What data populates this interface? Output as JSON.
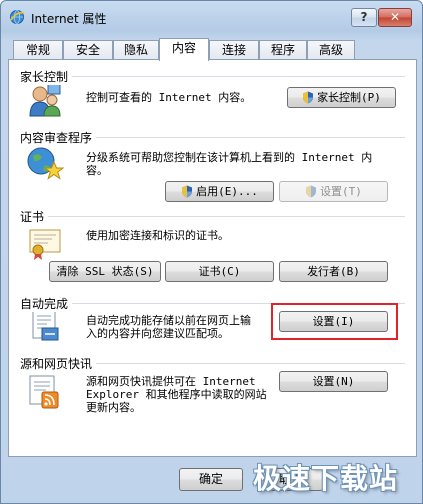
{
  "window": {
    "title": "Internet 属性",
    "help_label": "?",
    "close_label": "✕"
  },
  "tabs": [
    {
      "label": "常规"
    },
    {
      "label": "安全"
    },
    {
      "label": "隐私"
    },
    {
      "label": "内容",
      "active": true
    },
    {
      "label": "连接"
    },
    {
      "label": "程序"
    },
    {
      "label": "高级"
    }
  ],
  "sections": {
    "parental": {
      "title": "家长控制",
      "text": "控制可查看的 Internet 内容。",
      "button": "家长控制(P)",
      "icon": "parental-control-icon"
    },
    "advisor": {
      "title": "内容审查程序",
      "text_line1": "分级系统可帮助您控制在该计算机上看到的 Internet 内",
      "text_line2": "容。",
      "enable_button": "启用(E)...",
      "settings_button": "设置(T)",
      "icon": "content-advisor-icon"
    },
    "certificates": {
      "title": "证书",
      "text": "使用加密连接和标识的证书。",
      "clear_ssl_button": "清除 SSL 状态(S)",
      "certificates_button": "证书(C)",
      "publishers_button": "发行者(B)",
      "icon": "certificate-icon"
    },
    "autocomplete": {
      "title": "自动完成",
      "text_line1": "自动完成功能存储以前在网页上输",
      "text_line2": "入的内容并向您建议匹配项。",
      "settings_button": "设置(I)",
      "icon": "autocomplete-icon"
    },
    "feeds": {
      "title": "源和网页快讯",
      "text_line1": "源和网页快讯提供可在 Internet",
      "text_line2": "Explorer 和其他程序中读取的网站",
      "text_line3": "更新内容。",
      "settings_button": "设置(N)",
      "icon": "rss-feed-icon"
    }
  },
  "footer": {
    "ok_button": "确定",
    "cancel_button": "取消"
  },
  "watermark": "极速下载站",
  "colors": {
    "highlight": "#e0242a",
    "title_gradient": "#c9dcf0"
  }
}
